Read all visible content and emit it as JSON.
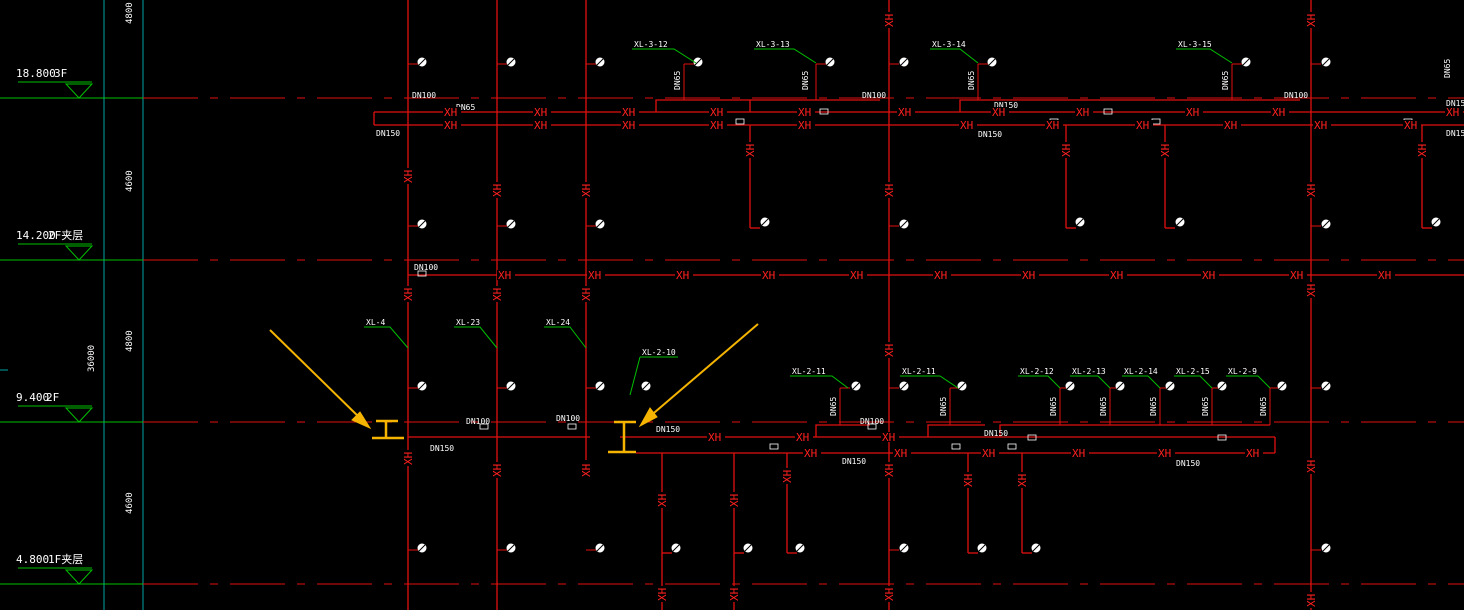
{
  "colors": {
    "background": "#000000",
    "pipe": "#e01010",
    "axis": "#00a3a3",
    "leader": "#00c000",
    "text": "#ffffff",
    "level_line": "#00c000",
    "annotation": "#f5b400"
  },
  "levels": [
    {
      "elev": "18.800",
      "name": "3F"
    },
    {
      "elev": "14.200",
      "name": "2F夹层"
    },
    {
      "elev": "9.400",
      "name": "2F"
    },
    {
      "elev": "4.800",
      "name": "1F夹层"
    }
  ],
  "dimensions": [
    "4800",
    "4600",
    "4800",
    "4600"
  ],
  "total_dimension": "36000",
  "risers": [
    "XL-3-12",
    "XL-3-13",
    "XL-3-14",
    "XL-3-15",
    "XL-4",
    "XL-23",
    "XL-24",
    "XL-2-10",
    "XL-2-11",
    "XL-2-11",
    "XL-2-12",
    "XL-2-13",
    "XL-2-14",
    "XL-2-15",
    "XL-2-9"
  ],
  "pipe_sizes": [
    "DN100",
    "DN150",
    "DN65",
    "DN150",
    "DN100",
    "DN150",
    "DN100",
    "DN150",
    "DN100",
    "DN150",
    "DN100",
    "DN100",
    "DN150",
    "DN100",
    "DN150",
    "DN150",
    "DN150",
    "DN150",
    "DN65",
    "DN65",
    "DN65",
    "DN65",
    "DN65",
    "DN65",
    "DN65",
    "DN65",
    "DN65",
    "DN65",
    "DN65",
    "DN65"
  ],
  "pipe_label": "XH",
  "markers": [
    "I",
    "I"
  ]
}
